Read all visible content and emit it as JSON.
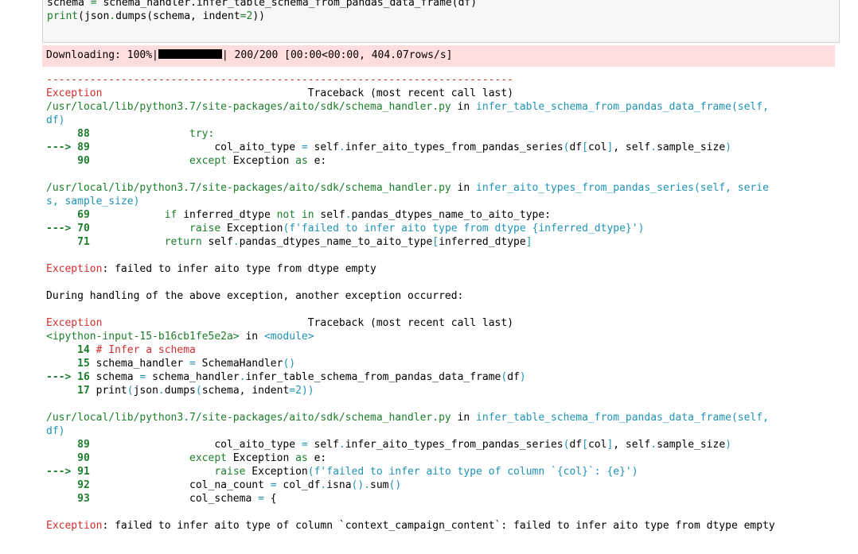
{
  "input_cell": {
    "line1": {
      "a": "schema ",
      "eq": "=",
      "b": " schema_handler.infer_table_schema_from_pandas_data_frame(df)"
    },
    "line2": {
      "fn": "print",
      "a": "(json",
      "dot": ".",
      "b": "dumps(schema, indent",
      "eq": "=",
      "num": "2",
      "c": "))"
    }
  },
  "stderr": {
    "text_before": "Downloading: 100%|",
    "text_after": "| 200/200 [00:00<00:00, 404.07rows/s]"
  },
  "traceback": {
    "separator": "---------------------------------------------------------------------------",
    "frame1_header": {
      "exc": "Exception",
      "pad": "                                 ",
      "title": "Traceback (most recent call last)"
    },
    "frame1_file": "/usr/local/lib/python3.7/site-packages/aito/sdk/schema_handler.py",
    "frame1_in": " in ",
    "frame1_func_a": "infer_table_schema_from_pandas_data_frame(self,",
    "frame1_func_b": "df)",
    "frame1_lines": {
      "l88_no": "     88",
      "l88_code": "                try:",
      "l89_no": "---> 89",
      "l89_a": "                    col_aito_type ",
      "l89_eq": "=",
      "l89_b": " self",
      "l89_d1": ".",
      "l89_c": "infer_aito_types_from_pandas_series",
      "l89_p1": "(",
      "l89_d": "df",
      "l89_br1": "[",
      "l89_e": "col",
      "l89_br2": "]",
      "l89_f": ", self",
      "l89_d2": ".",
      "l89_g": "sample_size",
      "l89_p2": ")",
      "l90_no": "     90",
      "l90_a": "                ",
      "l90_kw": "except",
      "l90_b": " Exception ",
      "l90_as": "as",
      "l90_c": " e:"
    },
    "frame2_file": "/usr/local/lib/python3.7/site-packages/aito/sdk/schema_handler.py",
    "frame2_in": " in ",
    "frame2_func_a": "infer_aito_types_from_pandas_series(self, serie",
    "frame2_func_b": "s, sample_size)",
    "frame2_lines": {
      "l69_no": "     69",
      "l69_a": "            ",
      "l69_kw": "if",
      "l69_b": " inferred_dtype ",
      "l69_not": "not",
      "l69_sp": " ",
      "l69_in": "in",
      "l69_c": " self",
      "l69_d": ".",
      "l69_e": "pandas_dtypes_name_to_aito_type:",
      "l70_no": "---> 70",
      "l70_a": "                ",
      "l70_kw": "raise",
      "l70_b": " Exception",
      "l70_s": "(f'failed to infer aito type from dtype {inferred_dtype}')",
      "l71_no": "     71",
      "l71_a": "            ",
      "l71_kw": "return",
      "l71_b": " self",
      "l71_d": ".",
      "l71_c": "pandas_dtypes_name_to_aito_type",
      "l71_br1": "[",
      "l71_e": "inferred_dtype",
      "l71_br2": "]"
    },
    "exception1": {
      "name": "Exception",
      "msg": ": failed to infer aito type from dtype empty"
    },
    "during_handling": "During handling of the above exception, another exception occurred:",
    "frame3_header": {
      "exc": "Exception",
      "pad": "                                 ",
      "title": "Traceback (most recent call last)"
    },
    "frame3_file": "<ipython-input-15-b16cb1fe5e2a>",
    "frame3_in": " in ",
    "frame3_module": "<module>",
    "frame3_lines": {
      "l14_no": "     14",
      "l14_comment": " # Infer a schema",
      "l15_no": "     15",
      "l15_a": " schema_handler ",
      "l15_eq": "=",
      "l15_b": " SchemaHandler",
      "l15_p": "()",
      "l16_no": "---> 16",
      "l16_a": " schema ",
      "l16_eq": "=",
      "l16_b": " schema_handler",
      "l16_d": ".",
      "l16_c": "infer_table_schema_from_pandas_data_frame",
      "l16_p1": "(",
      "l16_e": "df",
      "l16_p2": ")",
      "l17_no": "     17",
      "l17_a": " print",
      "l17_p1": "(",
      "l17_b": "json",
      "l17_d": ".",
      "l17_c": "dumps",
      "l17_p2": "(",
      "l17_e": "schema",
      "l17_f": ", indent",
      "l17_eq": "=",
      "l17_num": "2",
      "l17_p3": "))"
    },
    "frame4_file": "/usr/local/lib/python3.7/site-packages/aito/sdk/schema_handler.py",
    "frame4_in": " in ",
    "frame4_func_a": "infer_table_schema_from_pandas_data_frame(self,",
    "frame4_func_b": "df)",
    "frame4_lines": {
      "l89_no": "     89",
      "l89_a": "                    col_aito_type ",
      "l89_eq": "=",
      "l89_b": " self",
      "l89_d1": ".",
      "l89_c": "infer_aito_types_from_pandas_series",
      "l89_p1": "(",
      "l89_d": "df",
      "l89_br1": "[",
      "l89_e": "col",
      "l89_br2": "]",
      "l89_f": ", self",
      "l89_d2": ".",
      "l89_g": "sample_size",
      "l89_p2": ")",
      "l90_no": "     90",
      "l90_a": "                ",
      "l90_kw": "except",
      "l90_b": " Exception ",
      "l90_as": "as",
      "l90_c": " e:",
      "l91_no": "---> 91",
      "l91_a": "                    ",
      "l91_kw": "raise",
      "l91_b": " Exception",
      "l91_s": "(f'failed to infer aito type of column `{col}`: {e}')",
      "l92_no": "     92",
      "l92_a": "                col_na_count ",
      "l92_eq": "=",
      "l92_b": " col_df",
      "l92_d1": ".",
      "l92_c": "isna",
      "l92_p1": "()",
      "l92_d2": ".",
      "l92_e": "sum",
      "l92_p2": "()",
      "l93_no": "     93",
      "l93_a": "                col_schema ",
      "l93_eq": "=",
      "l93_b": " {"
    },
    "exception2": {
      "name": "Exception",
      "msg": ": failed to infer aito type of column `context_campaign_content`: failed to infer aito type from dtype empty"
    }
  },
  "colors": {
    "stderr_bg": "#ffdddd",
    "exception_red": "#d32f2f",
    "keyword_green": "#1b7f2a",
    "cyan": "#1f93b5"
  }
}
